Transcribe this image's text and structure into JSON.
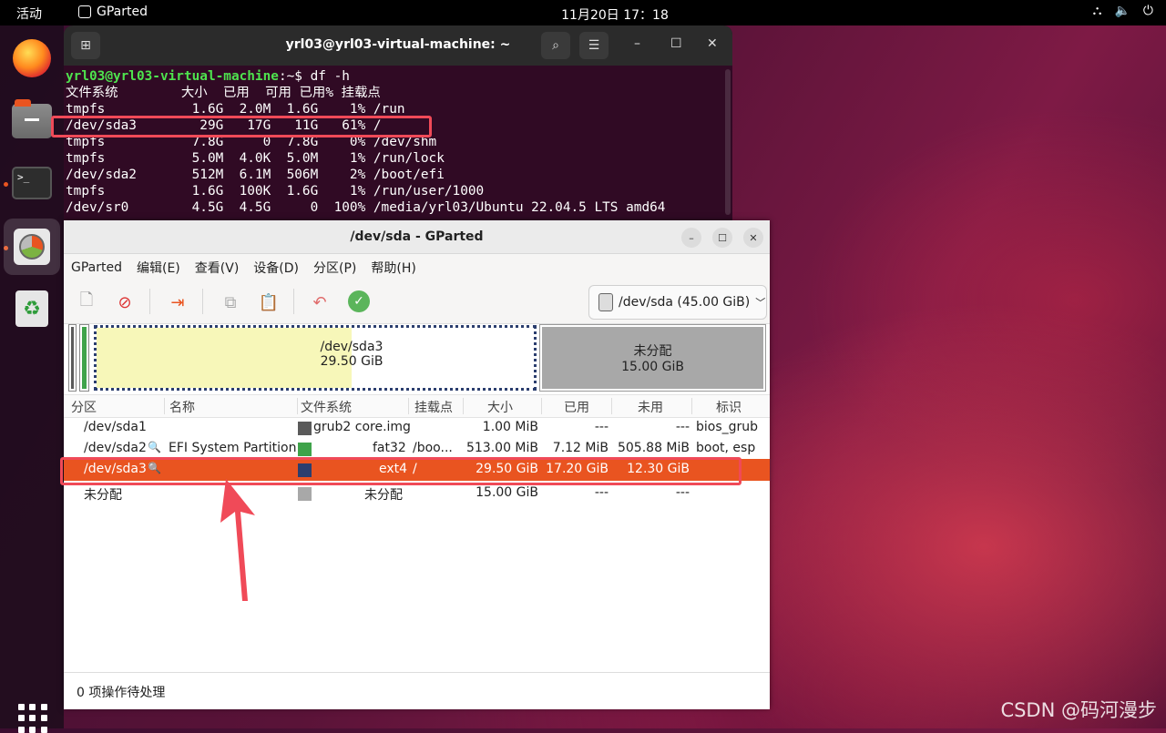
{
  "topbar": {
    "activities": "活动",
    "app": "GParted",
    "clock": "11月20日  17：18"
  },
  "dock": {
    "items": [
      "Firefox",
      "Files",
      "Terminal",
      "GParted",
      "Trash"
    ]
  },
  "terminal": {
    "title": "yrl03@yrl03-virtual-machine: ~",
    "prompt": "yrl03@yrl03-virtual-machine",
    "prompt_suffix": ":~$ df -h",
    "lines": [
      "文件系统        大小  已用  可用 已用% 挂载点",
      "tmpfs           1.6G  2.0M  1.6G    1% /run",
      "/dev/sda3        29G   17G   11G   61% /",
      "tmpfs           7.8G     0  7.8G    0% /dev/shm",
      "tmpfs           5.0M  4.0K  5.0M    1% /run/lock",
      "/dev/sda2       512M  6.1M  506M    2% /boot/efi",
      "tmpfs           1.6G  100K  1.6G    1% /run/user/1000",
      "/dev/sr0        4.5G  4.5G     0  100% /media/yrl03/Ubuntu 22.04.5 LTS amd64"
    ]
  },
  "gparted": {
    "title": "/dev/sda - GParted",
    "menu": [
      "GParted",
      "编辑(E)",
      "查看(V)",
      "设备(D)",
      "分区(P)",
      "帮助(H)"
    ],
    "device": "/dev/sda (45.00 GiB)",
    "map": {
      "sda3_label": "/dev/sda3",
      "sda3_size": "29.50 GiB",
      "unalloc_label": "未分配",
      "unalloc_size": "15.00 GiB",
      "sda3_used_fraction": 0.583
    },
    "columns": [
      "分区",
      "名称",
      "文件系统",
      "挂载点",
      "大小",
      "已用",
      "未用",
      "标识"
    ],
    "rows": [
      {
        "partition": "/dev/sda1",
        "name": "",
        "fs": "grub2 core.img",
        "mount": "",
        "size": "1.00 MiB",
        "used": "---",
        "unused": "---",
        "flags": "bios_grub",
        "color": "#5a5a5a"
      },
      {
        "partition": "/dev/sda2",
        "name": "EFI System Partition",
        "fs": "fat32",
        "mount": "/boo...",
        "size": "513.00 MiB",
        "used": "7.12 MiB",
        "unused": "505.88 MiB",
        "flags": "boot, esp",
        "color": "#3fa34a"
      },
      {
        "partition": "/dev/sda3",
        "name": "",
        "fs": "ext4",
        "mount": "/",
        "size": "29.50 GiB",
        "used": "17.20 GiB",
        "unused": "12.30 GiB",
        "flags": "",
        "color": "#2b3e6e"
      },
      {
        "partition": "未分配",
        "name": "",
        "fs": "未分配",
        "mount": "",
        "size": "15.00 GiB",
        "used": "---",
        "unused": "---",
        "flags": "",
        "color": "#a8a8a8"
      }
    ],
    "status": "0 项操作待处理"
  },
  "watermark": "CSDN @码河漫步"
}
